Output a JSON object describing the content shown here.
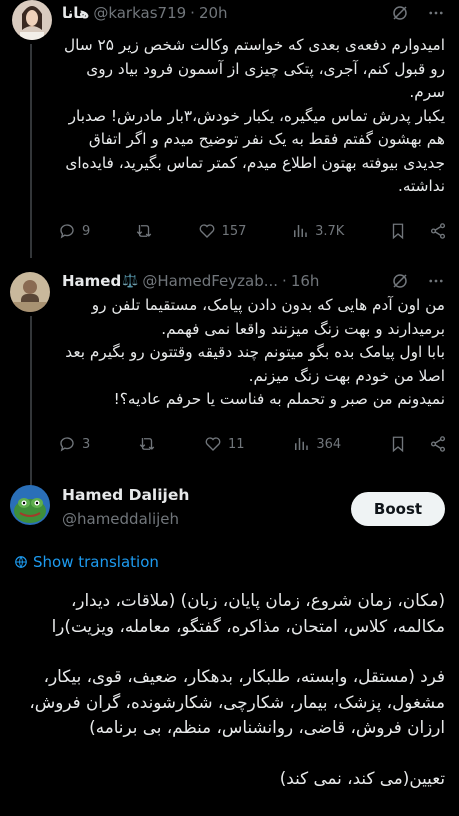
{
  "tweets": [
    {
      "name": "هانا",
      "handle": "@karkas719",
      "time": "20h",
      "paragraphs": [
        "امیدوارم دفعه‌ی بعدی که خواستم وکالت شخص زیر ۲۵ سال رو قبول کنم، آجری، پتکی چیزی از آسمون فرود بیاد روی سرم.",
        "یکبار پدرش تماس میگیره، یکبار خودش،۳بار مادرش! صدبار هم بهشون گفتم فقط به یک نفر توضیح میدم و اگر اتفاق جدیدی بیوفته بهتون اطلاع میدم، کمتر تماس بگیرید، فایده‌ای نداشته."
      ],
      "replies": "9",
      "retweets": "",
      "likes": "157",
      "views": "3.7K"
    },
    {
      "name": "Hamed",
      "name_emoji": "⚖️",
      "handle": "@HamedFeyzab...",
      "time": "16h",
      "paragraphs": [
        "من اون آدم هایی که بدون دادن پیامک، مستقیما تلفن رو برمیدارند و بهت زنگ میزنند واقعا نمی فهمم.",
        "بابا اول پیامک بده بگو میتونم چند دقیقه وقتتون رو بگیرم بعد اصلا من خودم بهت زنگ میزنم.",
        "نمیدونم من صبر و تحملم به فناست یا حرفم عادیه؟!"
      ],
      "replies": "3",
      "retweets": "",
      "likes": "11",
      "views": "364"
    }
  ],
  "main_tweet": {
    "name": "Hamed Dalijeh",
    "handle": "@hameddalijeh",
    "boost_label": "Boost",
    "show_translation": "Show translation",
    "paragraphs": [
      "(مکان، زمان شروع، زمان پایان، زبان) (ملاقات، دیدار، مکالمه، کلاس، امتحان، مذاکره، گفتگو، معامله، ویزیت)را",
      "فرد (مستقل، وابسته، طلبکار، بدهکار، ضعیف، قوی، بیکار، مشغول، پزشک، بیمار، شکارچی، شکارشونده، گران فروش، ارزان فروش، قاضی، روانشناس، منظم، بی برنامه)",
      "تعیین(می کند، نمی کند)"
    ]
  },
  "colors": {
    "background": "#000000",
    "text": "#e7e9ea",
    "muted": "#71767b",
    "link": "#1d9bf0",
    "button_bg": "#eff3f4"
  }
}
